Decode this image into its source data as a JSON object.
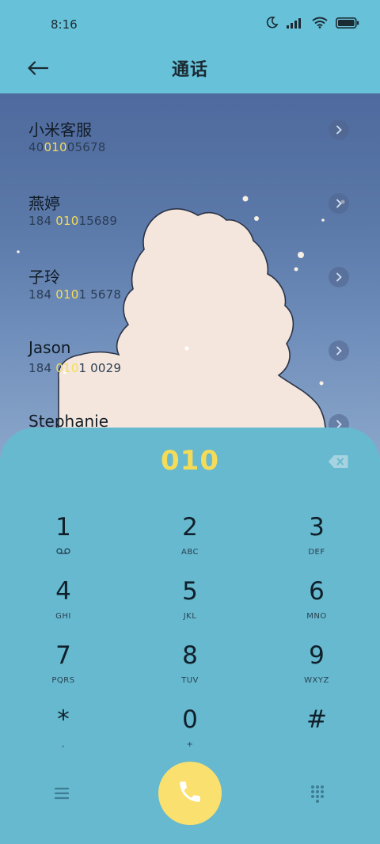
{
  "status_bar": {
    "time": "8:16"
  },
  "header": {
    "title": "通话"
  },
  "contacts": [
    {
      "name": "小米客服",
      "number_pre": "40",
      "number_match": "010",
      "number_post": "05678"
    },
    {
      "name": "燕婷",
      "number_pre": "184 ",
      "number_match": "010",
      "number_post": "15689"
    },
    {
      "name": "子玲",
      "number_pre": "184 ",
      "number_match": "010",
      "number_post": "1 5678"
    },
    {
      "name": "Jason",
      "number_pre": "184 ",
      "number_match": "010",
      "number_post": "1 0029"
    },
    {
      "name": "Stephanie",
      "number_pre": "",
      "number_match": "",
      "number_post": ""
    }
  ],
  "dialer": {
    "input": "010",
    "keys": [
      {
        "digit": "1",
        "sub": ""
      },
      {
        "digit": "2",
        "sub": "ABC"
      },
      {
        "digit": "3",
        "sub": "DEF"
      },
      {
        "digit": "4",
        "sub": "GHI"
      },
      {
        "digit": "5",
        "sub": "JKL"
      },
      {
        "digit": "6",
        "sub": "MNO"
      },
      {
        "digit": "7",
        "sub": "PQRS"
      },
      {
        "digit": "8",
        "sub": "TUV"
      },
      {
        "digit": "9",
        "sub": "WXYZ"
      },
      {
        "digit": "*",
        "sub": ","
      },
      {
        "digit": "0",
        "sub": "+"
      },
      {
        "digit": "#",
        "sub": ""
      }
    ]
  },
  "icons": {
    "status": [
      "moon-icon",
      "signal-icon",
      "wifi-icon",
      "battery-icon"
    ],
    "back": "arrow-left-icon",
    "contact_arrow": "chevron-right-icon",
    "backspace": "backspace-icon",
    "voicemail": "voicemail-icon",
    "menu": "menu-icon",
    "call": "phone-icon",
    "dialpad": "dialpad-grid-icon"
  },
  "colors": {
    "accent": "#f5dc58",
    "header_bg": "#67c1d8",
    "dialpad_bg": "#67b9d0",
    "call_button": "#fae06e"
  }
}
